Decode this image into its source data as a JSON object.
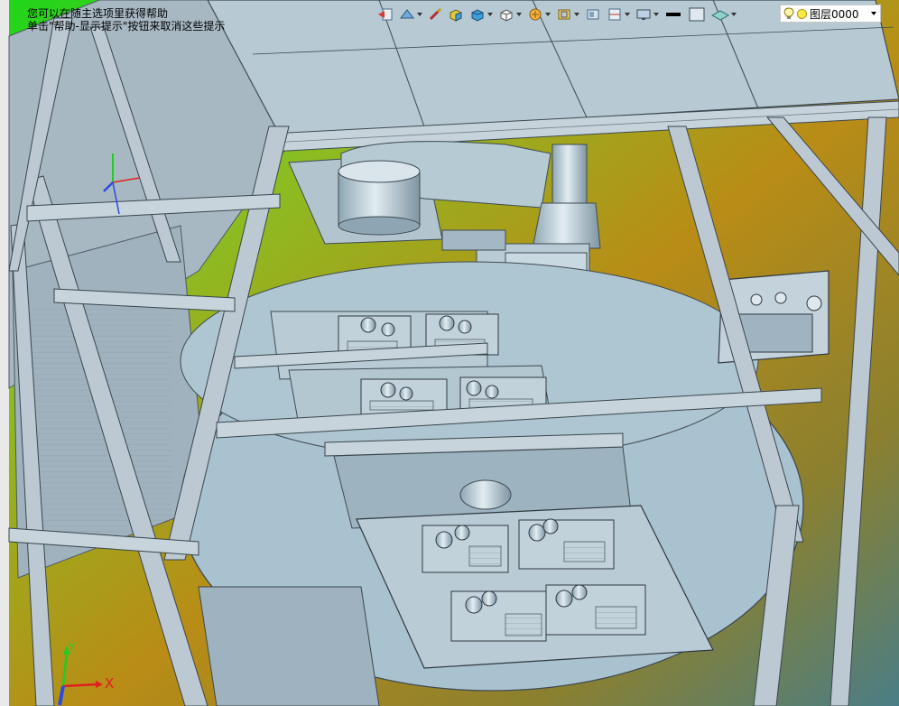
{
  "hint": {
    "line1": "您可以在随主选项里获得帮助",
    "line2": "单击\"帮助-显示提示\"按钮来取消这些提示"
  },
  "toolbar": {
    "items": [
      {
        "name": "exit-view-icon"
      },
      {
        "name": "render-mode-icon"
      },
      {
        "name": "measure-icon"
      },
      {
        "name": "shaded-box-icon"
      },
      {
        "name": "solid-box-icon"
      },
      {
        "name": "view-orientation-icon"
      },
      {
        "name": "render-style-icon"
      },
      {
        "name": "lighting-icon"
      },
      {
        "name": "section-view-icon"
      },
      {
        "name": "display-option-icon"
      },
      {
        "name": "screen-display-icon"
      },
      {
        "name": "line-color-icon"
      },
      {
        "name": "fill-color-icon"
      },
      {
        "name": "surface-color-icon"
      }
    ]
  },
  "layer": {
    "name": "图层0000"
  },
  "axes": {
    "x": "X",
    "y": "Y"
  },
  "colors": {
    "frame": "#b9c6cf",
    "frame_dark": "#6f7d87",
    "surface": "#a9c2cf",
    "surface_light": "#c9d9e2",
    "panel_face": "#c3d2db",
    "bg_green": "#1dd61a",
    "bg_gold": "#b98c16",
    "bg_teal": "#4a7e86"
  }
}
